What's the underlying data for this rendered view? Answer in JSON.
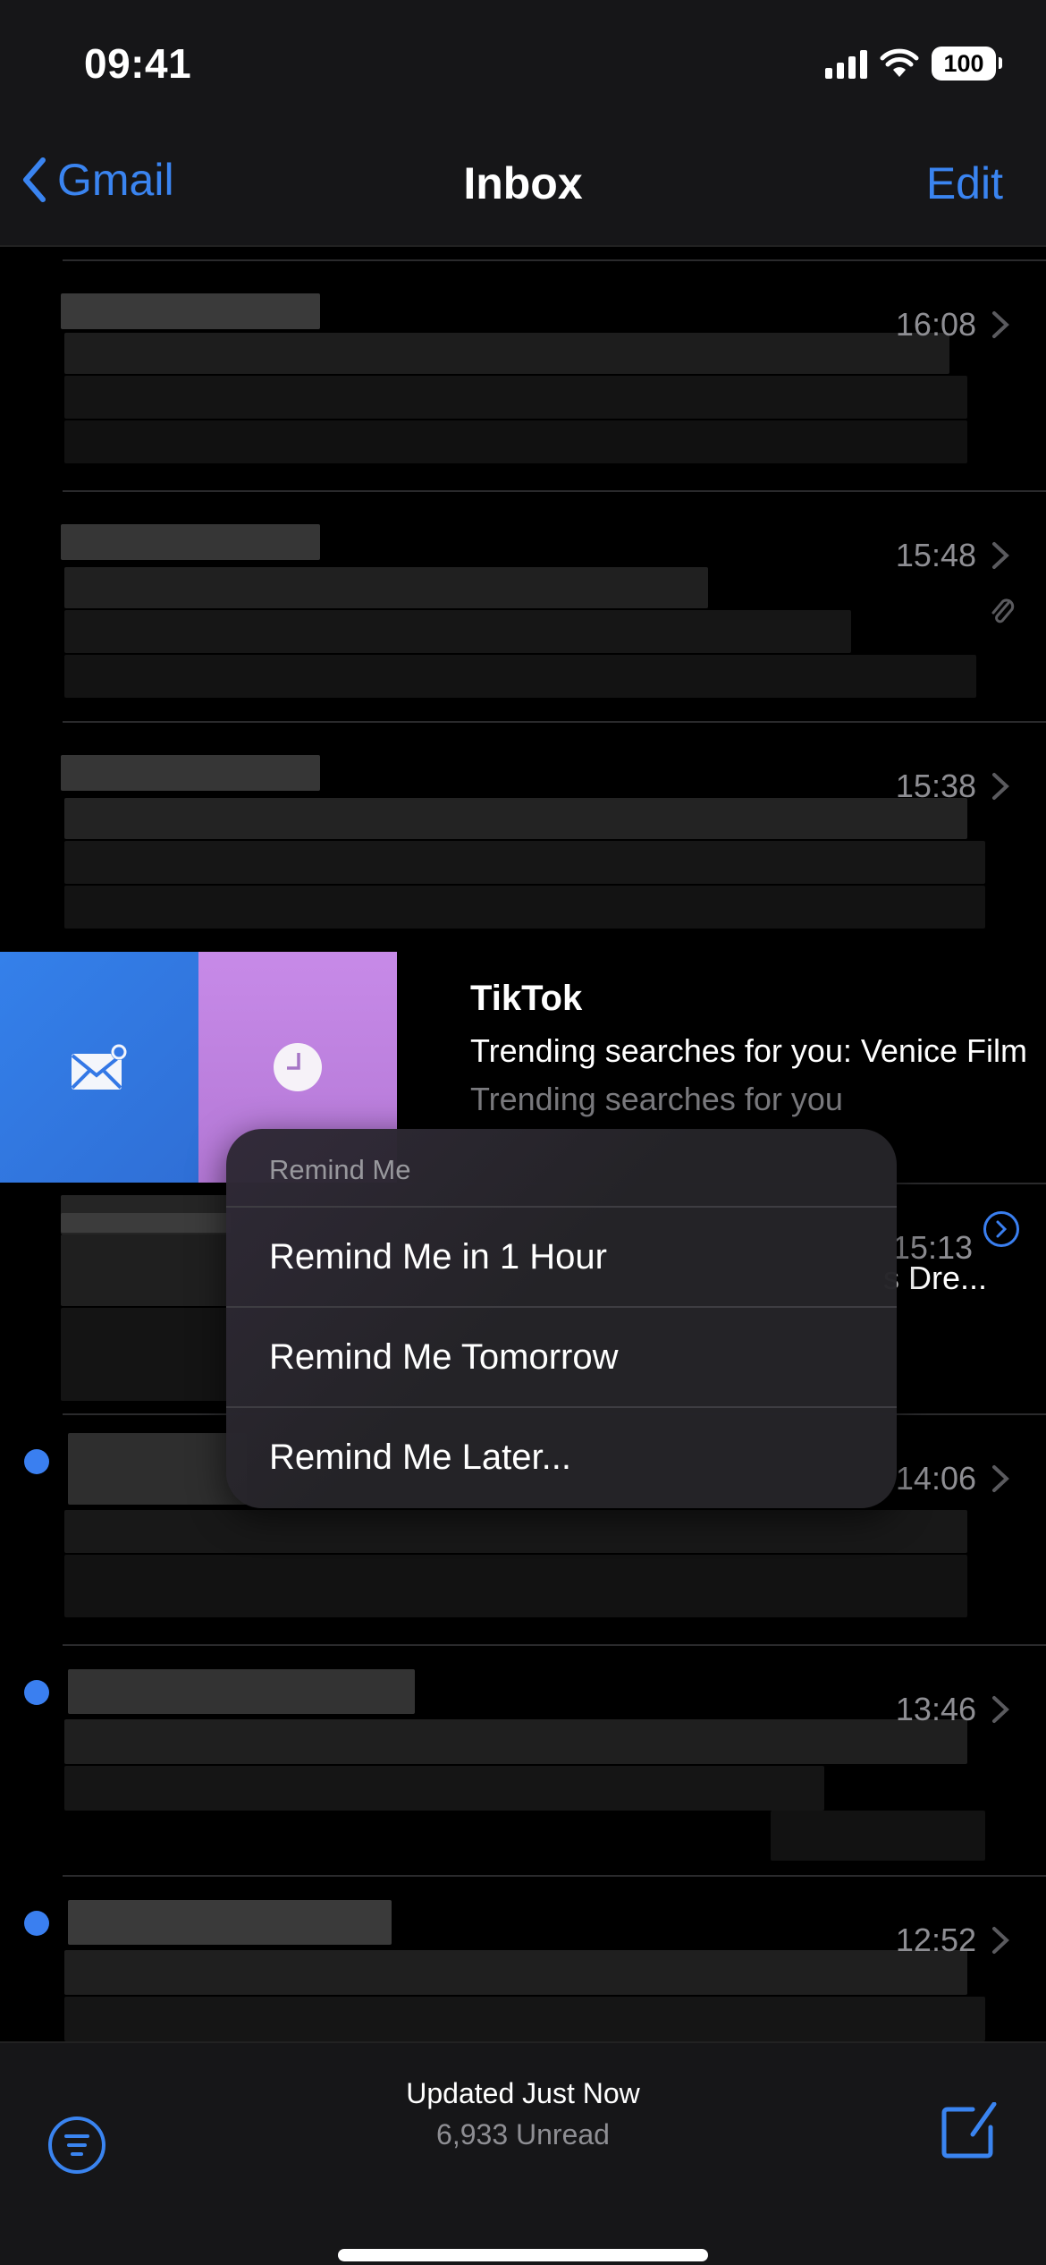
{
  "status_bar": {
    "time": "09:41",
    "battery": "100"
  },
  "nav": {
    "back_label": "Gmail",
    "title": "Inbox",
    "edit_label": "Edit"
  },
  "accent_color": "#3a84f0",
  "messages": [
    {
      "time": "16:08",
      "unread": false,
      "attachment": false,
      "redacted": true
    },
    {
      "time": "15:48",
      "unread": false,
      "attachment": true,
      "redacted": true
    },
    {
      "time": "15:38",
      "unread": false,
      "attachment": false,
      "redacted": true
    },
    {
      "sender": "TikTok",
      "subject": "Trending searches for you: Venice Film",
      "preview": "Trending searches for you",
      "swiped": true
    },
    {
      "time": "15:13",
      "unread": false,
      "subject_tail": "s Dre...",
      "has_info_chevron": true,
      "redacted": true
    },
    {
      "time": "14:06",
      "unread": true,
      "redacted": true
    },
    {
      "time": "13:46",
      "unread": true,
      "redacted": true
    },
    {
      "time": "12:52",
      "unread": true,
      "redacted": true
    }
  ],
  "swipe_actions": {
    "mark_label": "mark-unread",
    "remind_label": "remind-me"
  },
  "remind_menu": {
    "header": "Remind Me",
    "items": [
      "Remind Me in 1 Hour",
      "Remind Me Tomorrow",
      "Remind Me Later..."
    ]
  },
  "bottom_bar": {
    "status": "Updated Just Now",
    "unread_count": "6,933 Unread"
  }
}
